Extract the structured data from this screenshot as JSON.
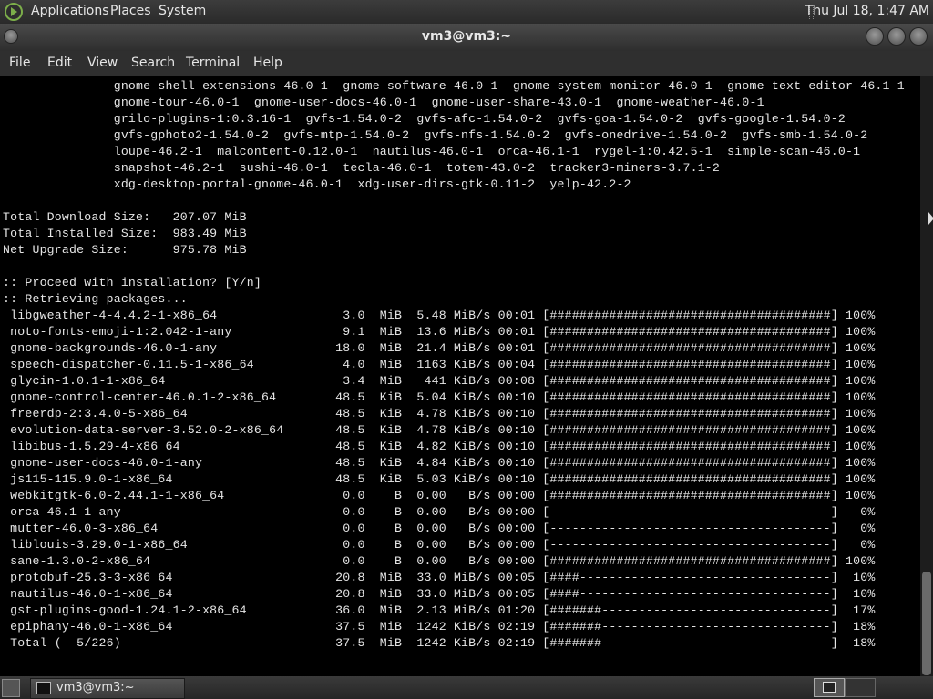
{
  "top_panel": {
    "menus": [
      "Applications",
      "Places",
      "System"
    ],
    "clock": "Thu Jul 18,  1:47 AM"
  },
  "window": {
    "title": "vm3@vm3:~"
  },
  "menubar": [
    "File",
    "Edit",
    "View",
    "Search",
    "Terminal",
    "Help"
  ],
  "terminal": {
    "lines": [
      "               gnome-shell-extensions-46.0-1  gnome-software-46.0-1  gnome-system-monitor-46.0-1  gnome-text-editor-46.1-1",
      "               gnome-tour-46.0-1  gnome-user-docs-46.0-1  gnome-user-share-43.0-1  gnome-weather-46.0-1",
      "               grilo-plugins-1:0.3.16-1  gvfs-1.54.0-2  gvfs-afc-1.54.0-2  gvfs-goa-1.54.0-2  gvfs-google-1.54.0-2",
      "               gvfs-gphoto2-1.54.0-2  gvfs-mtp-1.54.0-2  gvfs-nfs-1.54.0-2  gvfs-onedrive-1.54.0-2  gvfs-smb-1.54.0-2",
      "               loupe-46.2-1  malcontent-0.12.0-1  nautilus-46.0-1  orca-46.1-1  rygel-1:0.42.5-1  simple-scan-46.0-1",
      "               snapshot-46.2-1  sushi-46.0-1  tecla-46.0-1  totem-43.0-2  tracker3-miners-3.7.1-2",
      "               xdg-desktop-portal-gnome-46.0-1  xdg-user-dirs-gtk-0.11-2  yelp-42.2-2",
      "",
      "Total Download Size:   207.07 MiB",
      "Total Installed Size:  983.49 MiB",
      "Net Upgrade Size:      975.78 MiB",
      "",
      ":: Proceed with installation? [Y/n]",
      ":: Retrieving packages...",
      " libgweather-4-4.4.2-1-x86_64                 3.0  MiB  5.48 MiB/s 00:01 [######################################] 100%",
      " noto-fonts-emoji-1:2.042-1-any               9.1  MiB  13.6 MiB/s 00:01 [######################################] 100%",
      " gnome-backgrounds-46.0-1-any                18.0  MiB  21.4 MiB/s 00:01 [######################################] 100%",
      " speech-dispatcher-0.11.5-1-x86_64            4.0  MiB  1163 KiB/s 00:04 [######################################] 100%",
      " glycin-1.0.1-1-x86_64                        3.4  MiB   441 KiB/s 00:08 [######################################] 100%",
      " gnome-control-center-46.0.1-2-x86_64        48.5  KiB  5.04 KiB/s 00:10 [######################################] 100%",
      " freerdp-2:3.4.0-5-x86_64                    48.5  KiB  4.78 KiB/s 00:10 [######################################] 100%",
      " evolution-data-server-3.52.0-2-x86_64       48.5  KiB  4.78 KiB/s 00:10 [######################################] 100%",
      " libibus-1.5.29-4-x86_64                     48.5  KiB  4.82 KiB/s 00:10 [######################################] 100%",
      " gnome-user-docs-46.0-1-any                  48.5  KiB  4.84 KiB/s 00:10 [######################################] 100%",
      " js115-115.9.0-1-x86_64                      48.5  KiB  5.03 KiB/s 00:10 [######################################] 100%",
      " webkitgtk-6.0-2.44.1-1-x86_64                0.0    B  0.00   B/s 00:00 [######################################] 100%",
      " orca-46.1-1-any                              0.0    B  0.00   B/s 00:00 [--------------------------------------]   0%",
      " mutter-46.0-3-x86_64                         0.0    B  0.00   B/s 00:00 [--------------------------------------]   0%",
      " liblouis-3.29.0-1-x86_64                     0.0    B  0.00   B/s 00:00 [--------------------------------------]   0%",
      " sane-1.3.0-2-x86_64                          0.0    B  0.00   B/s 00:00 [######################################] 100%",
      " protobuf-25.3-3-x86_64                      20.8  MiB  33.0 MiB/s 00:05 [####----------------------------------]  10%",
      " nautilus-46.0-1-x86_64                      20.8  MiB  33.0 MiB/s 00:05 [####----------------------------------]  10%",
      " gst-plugins-good-1.24.1-2-x86_64            36.0  MiB  2.13 MiB/s 01:20 [#######-------------------------------]  17%",
      " epiphany-46.0-1-x86_64                      37.5  MiB  1242 KiB/s 02:19 [#######-------------------------------]  18%",
      " Total (  5/226)                             37.5  MiB  1242 KiB/s 02:19 [#######-------------------------------]  18%"
    ]
  },
  "taskbar": {
    "task_label": "vm3@vm3:~"
  }
}
